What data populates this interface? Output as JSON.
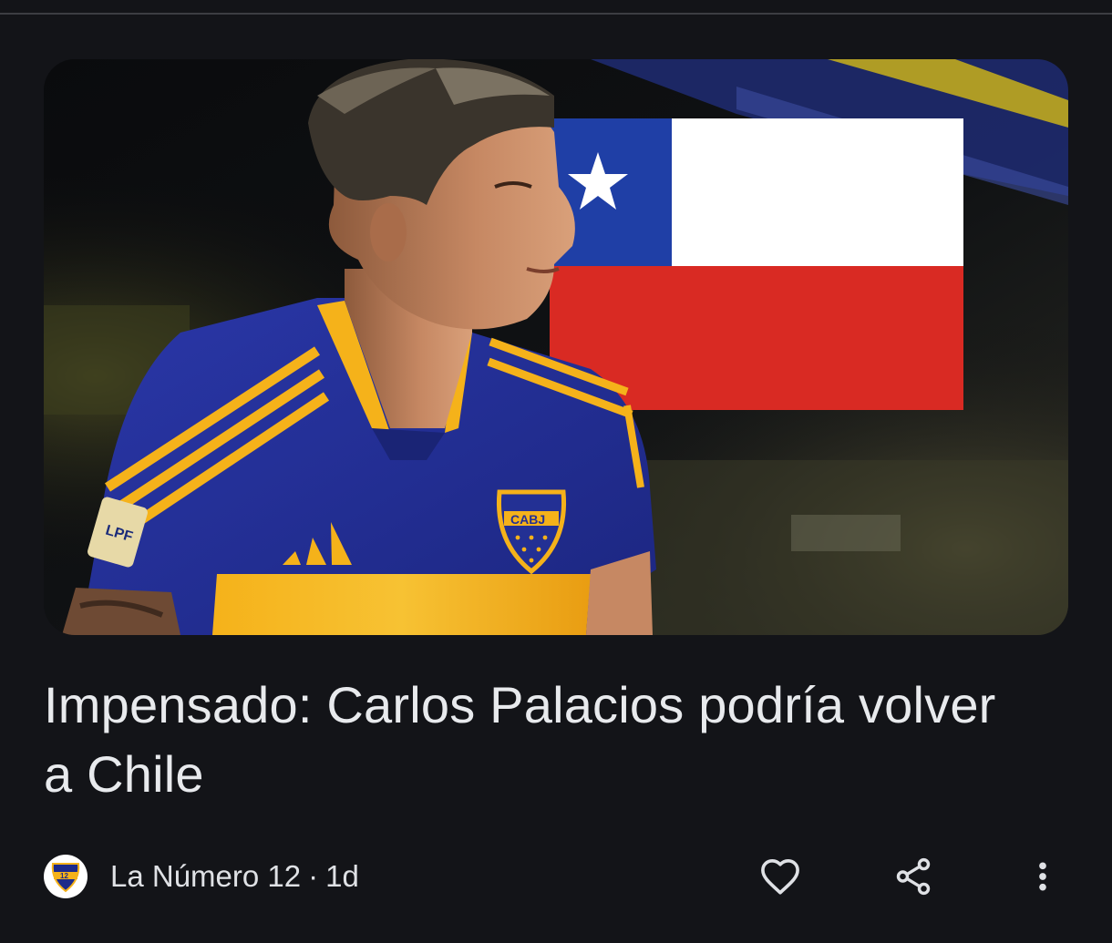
{
  "article": {
    "headline": "Impensado: Carlos Palacios podría volver a Chile",
    "image": {
      "description_icon": "player-photo",
      "jersey_badge_text": "CABJ",
      "sleeve_patch_text": "LPF"
    },
    "source": {
      "logo_text": "12",
      "name": "La Número 12",
      "separator": "·",
      "age": "1d"
    }
  },
  "actions": {
    "like_icon": "heart-outline-icon",
    "share_icon": "share-icon",
    "more_icon": "more-vert-icon"
  },
  "colors": {
    "background": "#131418",
    "text": "#e8eaed",
    "flag_blue": "#1f3fa6",
    "flag_red": "#d92a23",
    "jersey_blue": "#23309a",
    "jersey_gold": "#f2b21c"
  }
}
